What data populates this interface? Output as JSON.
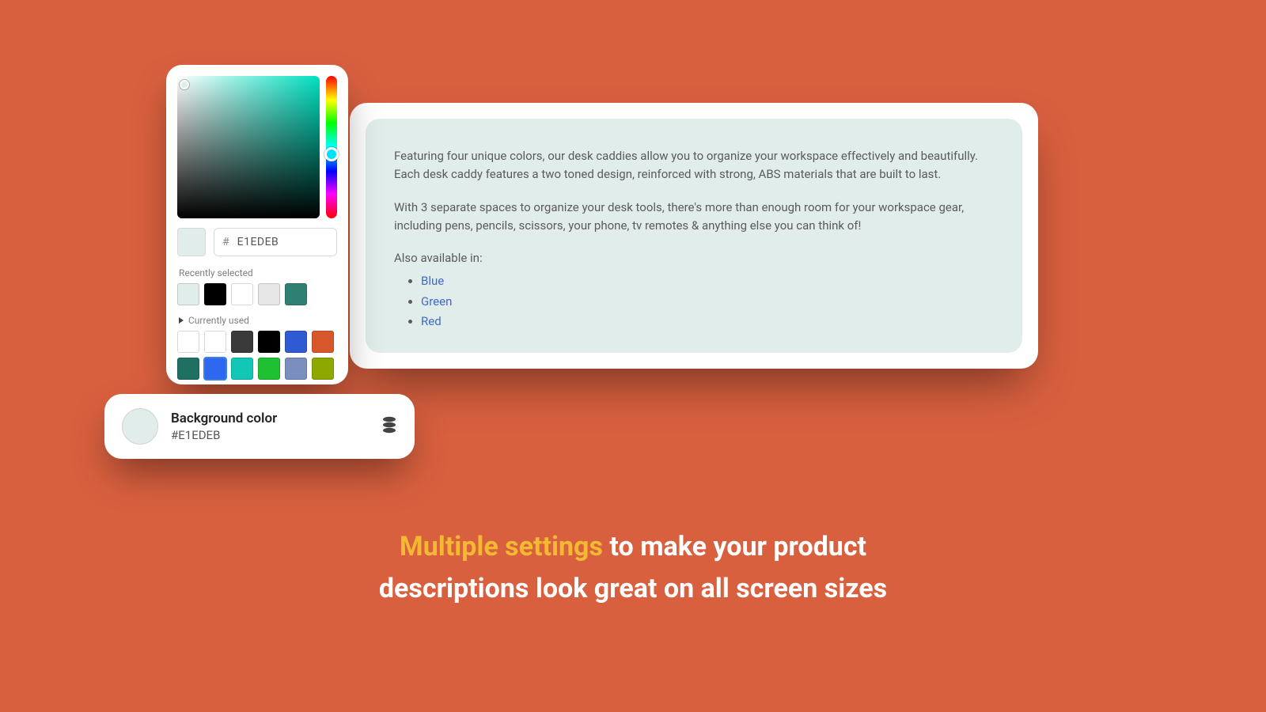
{
  "picker": {
    "hex_hash": "#",
    "hex_value": "E1EDEB",
    "current_swatch": "#e1edeb",
    "recent_label": "Recently selected",
    "recent": [
      {
        "color": "#e1edeb"
      },
      {
        "color": "#000000"
      },
      {
        "color": "#ffffff"
      },
      {
        "color": "#e6e6e6"
      },
      {
        "color": "#2f8072"
      }
    ],
    "used_label": "Currently used",
    "used": [
      {
        "color": "#ffffff"
      },
      {
        "color": "#ffffff"
      },
      {
        "color": "#3a3a3a"
      },
      {
        "color": "#000000"
      },
      {
        "color": "#305ad1"
      },
      {
        "color": "#d8582e"
      },
      {
        "color": "#1f6f63"
      },
      {
        "color": "#2f68f0",
        "selected": true
      },
      {
        "color": "#12c7b6"
      },
      {
        "color": "#1fc132"
      },
      {
        "color": "#7a8fbe"
      },
      {
        "color": "#8ea800"
      }
    ]
  },
  "setting": {
    "title": "Background color",
    "value": "#E1EDEB",
    "swatch": "#e1edeb"
  },
  "preview": {
    "bg": "#e1edeb",
    "p1": "Featuring four unique colors, our desk caddies allow you to organize your workspace effectively and beautifully. Each desk caddy features a two toned design, reinforced with strong, ABS materials that are built to last.",
    "p2": "With 3 separate spaces to organize your desk tools, there's more than enough room for your workspace gear, including pens, pencils, scissors, your phone, tv remotes & anything else you can think of!",
    "also_label": "Also available in:",
    "links": [
      "Blue",
      "Green",
      "Red"
    ]
  },
  "tagline": {
    "accent": "Multiple settings",
    "l1_rest": " to make your product",
    "l2": "descriptions look great on all screen sizes"
  }
}
